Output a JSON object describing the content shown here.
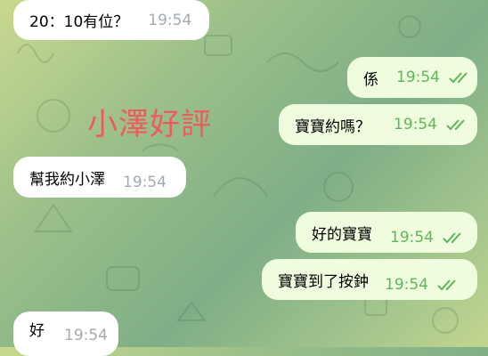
{
  "messages": [
    {
      "direction": "incoming",
      "text": "20：10有位？",
      "time": "19:54"
    },
    {
      "direction": "outgoing",
      "text": "係",
      "time": "19:54",
      "status": "read"
    },
    {
      "direction": "outgoing",
      "text": "寶寶約嗎？",
      "time": "19:54",
      "status": "read"
    },
    {
      "direction": "incoming",
      "text": "幫我約小澤",
      "time": "19:54"
    },
    {
      "direction": "outgoing",
      "text": "好的寶寶",
      "time": "19:54",
      "status": "read"
    },
    {
      "direction": "outgoing",
      "text": "寶寶到了按鈡",
      "time": "19:54",
      "status": "read"
    },
    {
      "direction": "incoming",
      "text": "好",
      "time": "19:54"
    }
  ],
  "overlay_text": "小澤好評",
  "colors": {
    "incoming_bubble": "#ffffff",
    "outgoing_bubble": "#effdde",
    "outgoing_time": "#5eb65a",
    "incoming_time": "#a1aab3",
    "overlay_text": "#f05a5a"
  },
  "icons": {
    "read_status": "double-check-icon"
  }
}
